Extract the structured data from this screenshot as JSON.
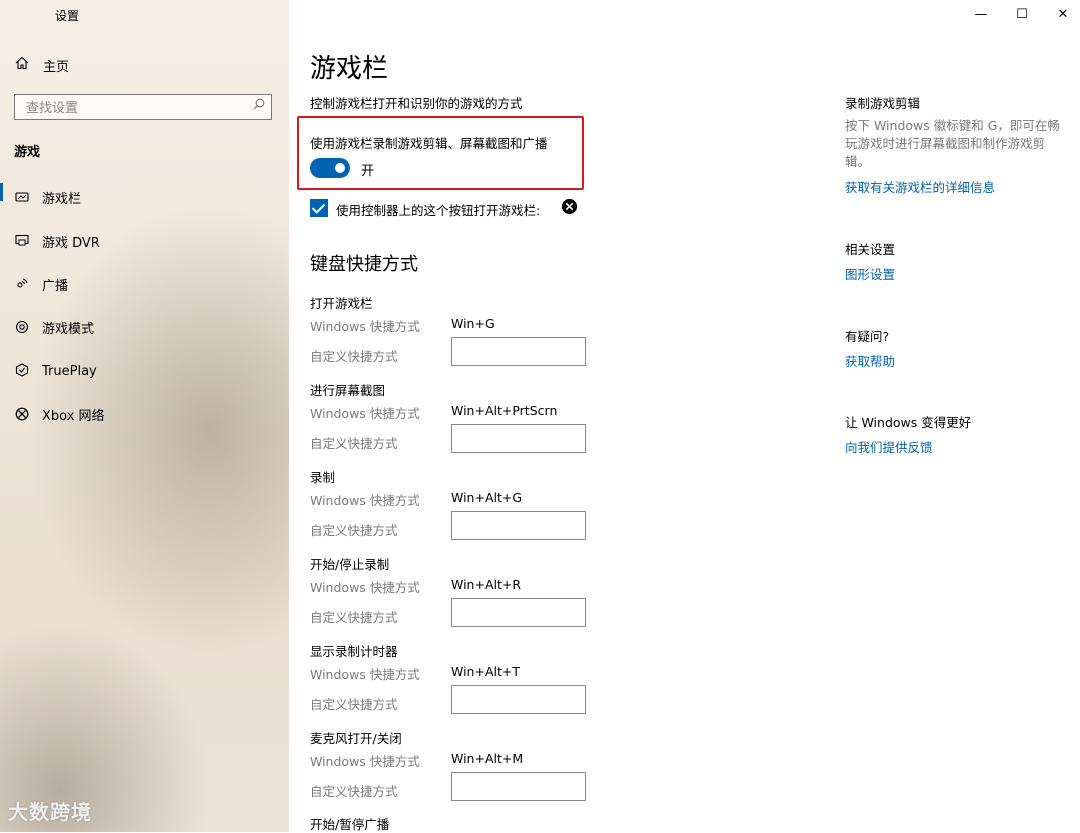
{
  "window": {
    "title": "设置",
    "minimize_glyph": "—",
    "maximize_glyph": "☐",
    "close_glyph": "✕"
  },
  "sidebar": {
    "back_glyph": "←",
    "home": {
      "label": "主页",
      "icon": "home-icon"
    },
    "search": {
      "placeholder": "查找设置",
      "icon": "search-icon"
    },
    "section": "游戏",
    "items": [
      {
        "label": "游戏栏",
        "icon": "game-bar-icon",
        "active": true
      },
      {
        "label": "游戏 DVR",
        "icon": "dvr-icon",
        "active": false
      },
      {
        "label": "广播",
        "icon": "broadcast-icon",
        "active": false
      },
      {
        "label": "游戏模式",
        "icon": "game-mode-icon",
        "active": false
      },
      {
        "label": "TruePlay",
        "icon": "trueplay-icon",
        "active": false
      },
      {
        "label": "Xbox 网络",
        "icon": "xbox-icon",
        "active": false
      }
    ],
    "watermark": "大数跨境"
  },
  "main": {
    "title": "游戏栏",
    "description": "控制游戏栏打开和识别你的游戏的方式",
    "toggle": {
      "label": "使用游戏栏录制游戏剪辑、屏幕截图和广播",
      "state": "开",
      "on": true
    },
    "checkbox": {
      "label": "使用控制器上的这个按钮打开游戏栏:",
      "checked": true
    },
    "shortcuts_heading": "键盘快捷方式",
    "windows_shortcut_label": "Windows 快捷方式",
    "custom_shortcut_label": "自定义快捷方式",
    "shortcuts": [
      {
        "title": "打开游戏栏",
        "windows": "Win+G",
        "custom": ""
      },
      {
        "title": "进行屏幕截图",
        "windows": "Win+Alt+PrtScrn",
        "custom": ""
      },
      {
        "title": "录制",
        "windows": "Win+Alt+G",
        "custom": ""
      },
      {
        "title": "开始/停止录制",
        "windows": "Win+Alt+R",
        "custom": ""
      },
      {
        "title": "显示录制计时器",
        "windows": "Win+Alt+T",
        "custom": ""
      },
      {
        "title": "麦克风打开/关闭",
        "windows": "Win+Alt+M",
        "custom": ""
      },
      {
        "title": "开始/暂停广播"
      }
    ]
  },
  "right": {
    "record_heading": "录制游戏剪辑",
    "record_text": "按下 Windows 徽标键和 G，即可在畅玩游戏时进行屏幕截图和制作游戏剪辑。",
    "record_link": "获取有关游戏栏的详细信息",
    "related_heading": "相关设置",
    "related_link": "图形设置",
    "question_heading": "有疑问?",
    "help_link": "获取帮助",
    "improve_heading": "让 Windows 变得更好",
    "feedback_link": "向我们提供反馈"
  },
  "colors": {
    "accent": "#0063b1",
    "highlight_border": "#e0141b"
  }
}
